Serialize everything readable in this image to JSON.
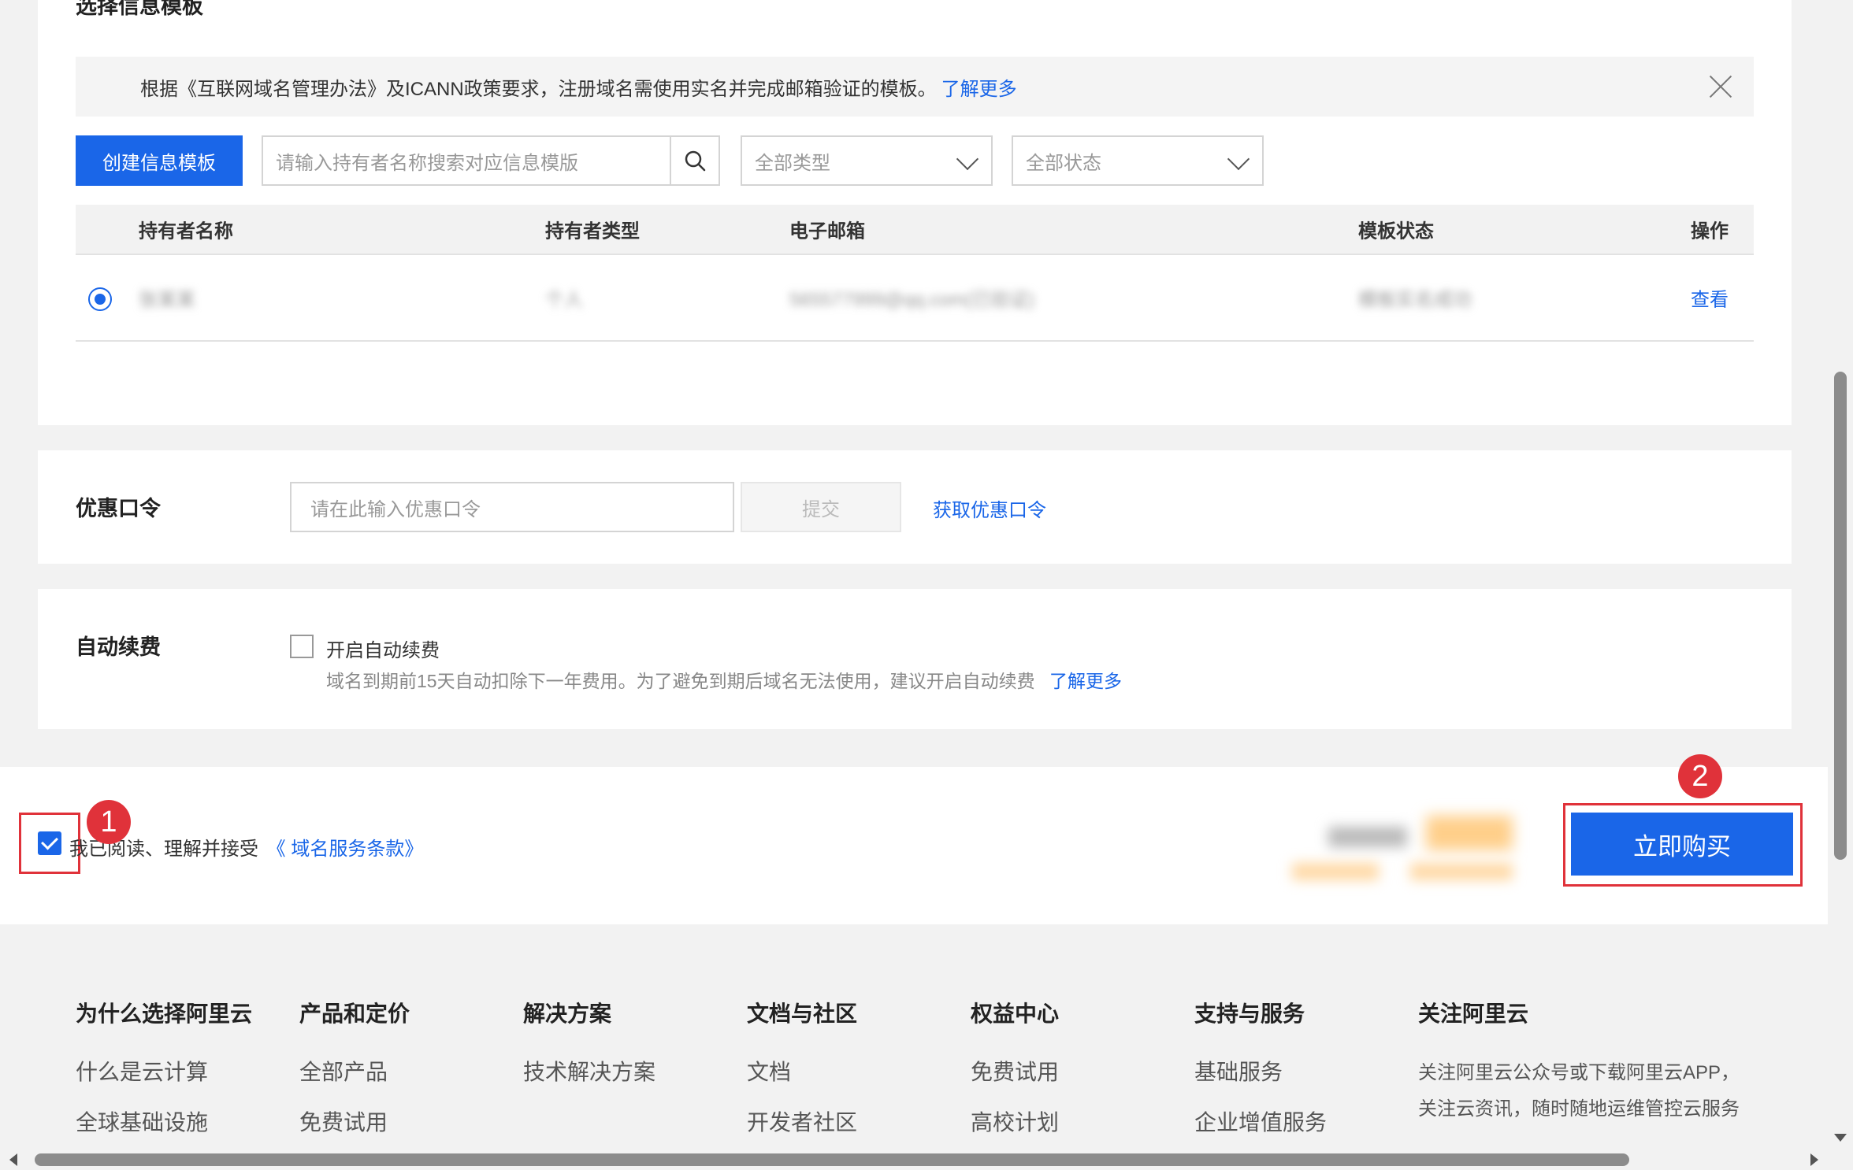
{
  "template_section": {
    "title": "选择信息模板",
    "notice_text": "根据《互联网域名管理办法》及ICANN政策要求，注册域名需使用实名并完成邮箱验证的模板。",
    "notice_link": "了解更多",
    "create_button": "创建信息模板",
    "search_placeholder": "请输入持有者名称搜索对应信息模版",
    "type_select": "全部类型",
    "status_select": "全部状态",
    "columns": {
      "name": "持有者名称",
      "type": "持有者类型",
      "email": "电子邮箱",
      "status": "模板状态",
      "action": "操作"
    },
    "row": {
      "name": "张某某",
      "type": "个人",
      "email": "565577999@qq.com(已验证)",
      "status": "模板实名成功",
      "action": "查看"
    }
  },
  "coupon_section": {
    "label": "优惠口令",
    "placeholder": "请在此输入优惠口令",
    "submit": "提交",
    "get_link": "获取优惠口令"
  },
  "renew_section": {
    "label": "自动续费",
    "checkbox_label": "开启自动续费",
    "desc": "域名到期前15天自动扣除下一年费用。为了避免到期后域名无法使用，建议开启自动续费",
    "link": "了解更多"
  },
  "bottom_bar": {
    "agree_text": "我已阅读、理解并接受",
    "agree_link": "《 域名服务条款》",
    "buy_button": "立即购买",
    "badge1": "1",
    "badge2": "2"
  },
  "footer": {
    "col1": {
      "title": "为什么选择阿里云",
      "items": [
        "什么是云计算",
        "全球基础设施"
      ]
    },
    "col2": {
      "title": "产品和定价",
      "items": [
        "全部产品",
        "免费试用"
      ]
    },
    "col3": {
      "title": "解决方案",
      "items": [
        "技术解决方案"
      ]
    },
    "col4": {
      "title": "文档与社区",
      "items": [
        "文档",
        "开发者社区"
      ]
    },
    "col5": {
      "title": "权益中心",
      "items": [
        "免费试用",
        "高校计划"
      ]
    },
    "col6": {
      "title": "支持与服务",
      "items": [
        "基础服务",
        "企业增值服务"
      ]
    },
    "col7": {
      "title": "关注阿里云",
      "lines": [
        "关注阿里云公众号或下载阿里云APP，",
        "关注云资讯，随时随地运维管控云服务"
      ]
    }
  },
  "colors": {
    "accent": "#1a66e8",
    "highlight": "#e0323a"
  }
}
